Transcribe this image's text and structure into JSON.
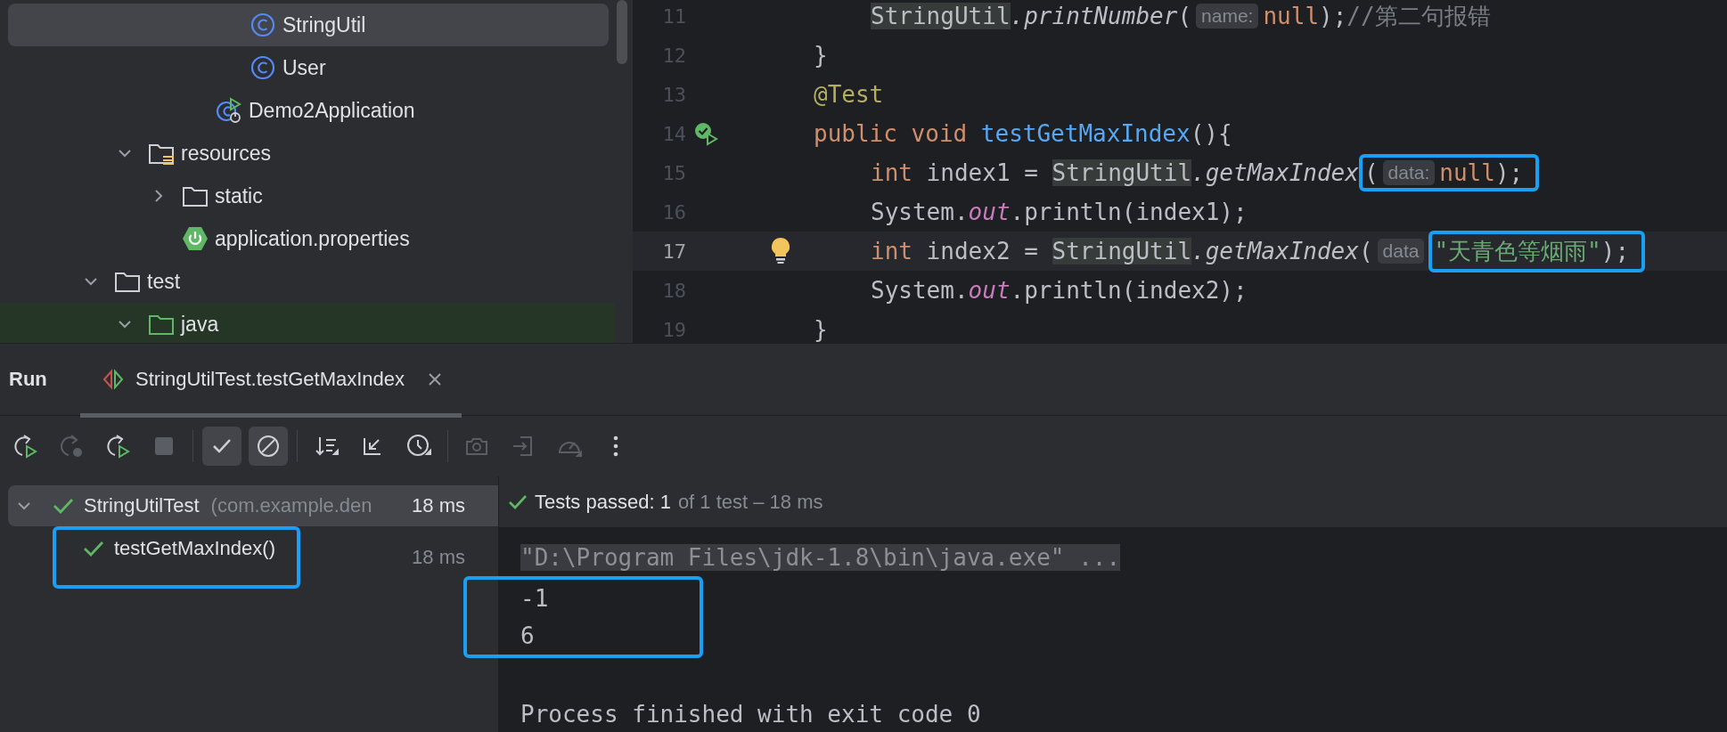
{
  "project_tree": [
    {
      "children": [
        {
          "children": [
            {
              "children": [
                {
                  "children": [
                    {
                      "label": "StringUtil",
                      "kind": "class",
                      "selected": true
                    },
                    {
                      "label": "User",
                      "kind": "class",
                      "selected": false
                    }
                  ]
                },
                {
                  "label": "Demo2Application",
                  "kind": "app-class",
                  "selected": false
                }
              ]
            }
          ]
        },
        {
          "label": "resources",
          "kind": "resources-folder",
          "expanded": true,
          "selected": false,
          "children": [
            {
              "label": "static",
              "kind": "folder",
              "expanded": false,
              "selected": false
            },
            {
              "label": "application.properties",
              "kind": "properties",
              "selected": false
            }
          ]
        }
      ]
    },
    {
      "label": "test",
      "kind": "folder",
      "expanded": true,
      "selected": false,
      "children": [
        {
          "label": "java",
          "kind": "test-folder",
          "expanded": true,
          "selected": false
        }
      ]
    }
  ],
  "editor": {
    "lines": [
      {
        "number": "11",
        "kind": "body",
        "current": false,
        "tokens": [
          {
            "kind": "classref",
            "text": "StringUtil"
          },
          {
            "kind": "call",
            "text": ".printNumber"
          },
          {
            "kind": "plain",
            "text": "("
          },
          {
            "kind": "hint",
            "text": "name:"
          },
          {
            "kind": "keyword",
            "text": "null"
          },
          {
            "kind": "plain",
            "text": ");"
          },
          {
            "kind": "comment",
            "text": "//第二句报错"
          }
        ]
      },
      {
        "number": "12",
        "kind": "member",
        "current": false,
        "tokens": [
          {
            "kind": "plain",
            "text": "}"
          }
        ]
      },
      {
        "number": "13",
        "kind": "member",
        "current": false,
        "tokens": [
          {
            "kind": "annotation",
            "text": "@Test"
          }
        ]
      },
      {
        "number": "14",
        "kind": "member",
        "current": false,
        "marker": {
          "kind": "run-passed"
        },
        "tokens": [
          {
            "kind": "keyword",
            "text": "public"
          },
          {
            "kind": "keyword",
            "text": " void"
          },
          {
            "kind": "decl",
            "text": " testGetMaxIndex"
          },
          {
            "kind": "plain",
            "text": "(){"
          }
        ]
      },
      {
        "number": "15",
        "kind": "body",
        "current": false,
        "tokens": [
          {
            "kind": "keyword",
            "text": "int"
          },
          {
            "kind": "plain",
            "text": " index1 = "
          },
          {
            "kind": "classref",
            "text": "StringUtil"
          },
          {
            "kind": "call",
            "text": ".getMaxIndex"
          },
          {
            "kind": "frame",
            "tokens": [
              {
                "kind": "plain",
                "text": "("
              },
              {
                "kind": "hint",
                "text": "data:"
              },
              {
                "kind": "keyword",
                "text": "null"
              },
              {
                "kind": "plain",
                "text": ");"
              }
            ]
          }
        ]
      },
      {
        "number": "16",
        "kind": "body",
        "current": false,
        "tokens": [
          {
            "kind": "plain",
            "text": "System."
          },
          {
            "kind": "static",
            "text": "out"
          },
          {
            "kind": "plain",
            "text": ".println(index1);"
          }
        ]
      },
      {
        "number": "17",
        "kind": "body",
        "current": true,
        "marker": {
          "kind": "bulb"
        },
        "tokens": [
          {
            "kind": "keyword",
            "text": "int"
          },
          {
            "kind": "plain",
            "text": " index2 = "
          },
          {
            "kind": "classref",
            "text": "StringUtil"
          },
          {
            "kind": "call",
            "text": ".getMaxIndex"
          },
          {
            "kind": "plain",
            "text": "("
          },
          {
            "kind": "hint",
            "text": "data"
          },
          {
            "kind": "frame",
            "tokens": [
              {
                "kind": "string",
                "text": "\"天青色等烟雨\""
              },
              {
                "kind": "plain",
                "text": ");"
              }
            ]
          }
        ]
      },
      {
        "number": "18",
        "kind": "body",
        "current": false,
        "tokens": [
          {
            "kind": "plain",
            "text": "System."
          },
          {
            "kind": "static",
            "text": "out"
          },
          {
            "kind": "plain",
            "text": ".println(index2);"
          }
        ]
      },
      {
        "number": "19",
        "kind": "member",
        "current": false,
        "tokens": [
          {
            "kind": "plain",
            "text": "}"
          }
        ]
      }
    ]
  },
  "run_panel": {
    "title": "Run",
    "tabs": [
      {
        "label": "StringUtilTest.testGetMaxIndex",
        "selected": true
      }
    ],
    "toolbar": [
      {
        "kind": "rerun",
        "disabled": false,
        "on": false
      },
      {
        "kind": "rerun-failed",
        "disabled": true,
        "on": false
      },
      {
        "kind": "rerun-auto",
        "disabled": false,
        "on": false
      },
      {
        "kind": "stop",
        "disabled": true,
        "on": false
      },
      {
        "kind": "separator"
      },
      {
        "kind": "show-passed",
        "disabled": false,
        "on": true
      },
      {
        "kind": "show-ignored",
        "disabled": false,
        "on": true
      },
      {
        "kind": "separator"
      },
      {
        "kind": "sort",
        "disabled": false,
        "on": false
      },
      {
        "kind": "collapse",
        "disabled": false,
        "on": false
      },
      {
        "kind": "history",
        "disabled": false,
        "on": false
      },
      {
        "kind": "separator"
      },
      {
        "kind": "camera",
        "disabled": true,
        "on": false
      },
      {
        "kind": "export",
        "disabled": true,
        "on": false
      },
      {
        "kind": "gauge",
        "disabled": true,
        "on": false
      },
      {
        "kind": "more",
        "disabled": false,
        "on": false
      }
    ],
    "test_tree": [
      {
        "label": "StringUtilTest",
        "detail": "(com.example.den",
        "duration": "18 ms",
        "passed": true,
        "expanded": true,
        "selected": true,
        "framed": false,
        "children": [
          {
            "label": "testGetMaxIndex()",
            "duration": "18 ms",
            "passed": true,
            "selected": false,
            "framed": true
          }
        ]
      }
    ],
    "summary": {
      "passed": true,
      "label": "Tests passed: 1",
      "detail": "of 1 test – 18 ms"
    },
    "console": [
      {
        "kind": "command",
        "text": "\"D:\\Program Files\\jdk-1.8\\bin\\java.exe\" ..."
      },
      {
        "kind": "frame",
        "lines": [
          {
            "text": "-1"
          },
          {
            "text": "6"
          }
        ]
      },
      {
        "kind": "blank"
      },
      {
        "kind": "output",
        "text": "Process finished with exit code 0"
      }
    ]
  }
}
